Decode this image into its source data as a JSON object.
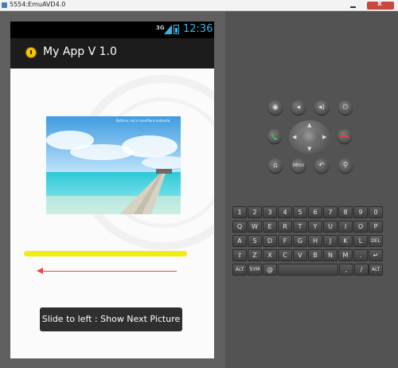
{
  "window": {
    "title": "5554:EmuAVD4.0"
  },
  "statusbar": {
    "network": "3G",
    "time": "12:36"
  },
  "app": {
    "title": "My App V 1.0"
  },
  "picture": {
    "caption": "Bothrus rail in maniflora ondonda"
  },
  "toast": {
    "text": "Slide to left : Show Next Picture"
  },
  "colors": {
    "accent": "#33b5e5",
    "highlight": "#f1ec18",
    "arrow": "#e74c3c"
  },
  "controls": {
    "top_row": [
      {
        "icon": "camera-icon",
        "glyph": "◉"
      },
      {
        "icon": "volume-down-icon",
        "glyph": "◂"
      },
      {
        "icon": "volume-up-icon",
        "glyph": "◂)"
      },
      {
        "icon": "power-icon",
        "glyph": "⏻"
      }
    ],
    "call_icon": "call-icon",
    "end_call_icon": "end-call-icon",
    "bottom_row": [
      {
        "icon": "home-icon",
        "glyph": "⌂"
      },
      {
        "icon": "menu-icon",
        "glyph": "MENU"
      },
      {
        "icon": "back-icon",
        "glyph": "↶"
      },
      {
        "icon": "search-icon",
        "glyph": "⚲"
      }
    ]
  },
  "keyboard": {
    "row1": [
      "1",
      "2",
      "3",
      "4",
      "5",
      "6",
      "7",
      "8",
      "9",
      "0"
    ],
    "row2": [
      "Q",
      "W",
      "E",
      "R",
      "T",
      "Y",
      "U",
      "I",
      "O",
      "P"
    ],
    "row3": [
      "A",
      "S",
      "D",
      "F",
      "G",
      "H",
      "J",
      "K",
      "L",
      "DEL"
    ],
    "row4": [
      "⇧",
      "Z",
      "X",
      "C",
      "V",
      "B",
      "N",
      "M",
      ".",
      "↵"
    ],
    "row5": [
      "ALT",
      "SYM",
      "@",
      "",
      ",",
      "/",
      "ALT"
    ]
  }
}
